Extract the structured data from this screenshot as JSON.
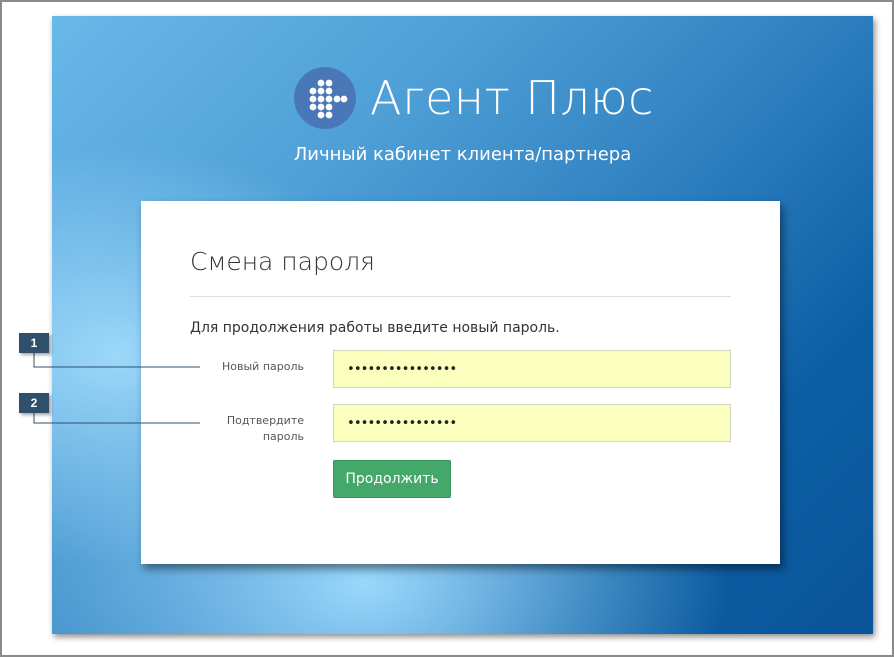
{
  "brand": {
    "name": "Агент Плюс",
    "subtitle": "Личный кабинет клиента/партнера",
    "logo_icon": "dot-matrix-logo-icon",
    "logo_color": "#4a77b8"
  },
  "form": {
    "title": "Смена пароля",
    "intro": "Для продолжения работы введите новый пароль.",
    "new_password": {
      "label": "Новый пароль",
      "value": "••••••••••••••••"
    },
    "confirm_password": {
      "label_line1": "Подтвердите",
      "label_line2": "пароль",
      "value": "••••••••••••••••"
    },
    "submit_label": "Продолжить",
    "submit_color": "#44a86a",
    "input_bg": "#fbffbd"
  },
  "callouts": [
    {
      "number": "1"
    },
    {
      "number": "2"
    }
  ]
}
